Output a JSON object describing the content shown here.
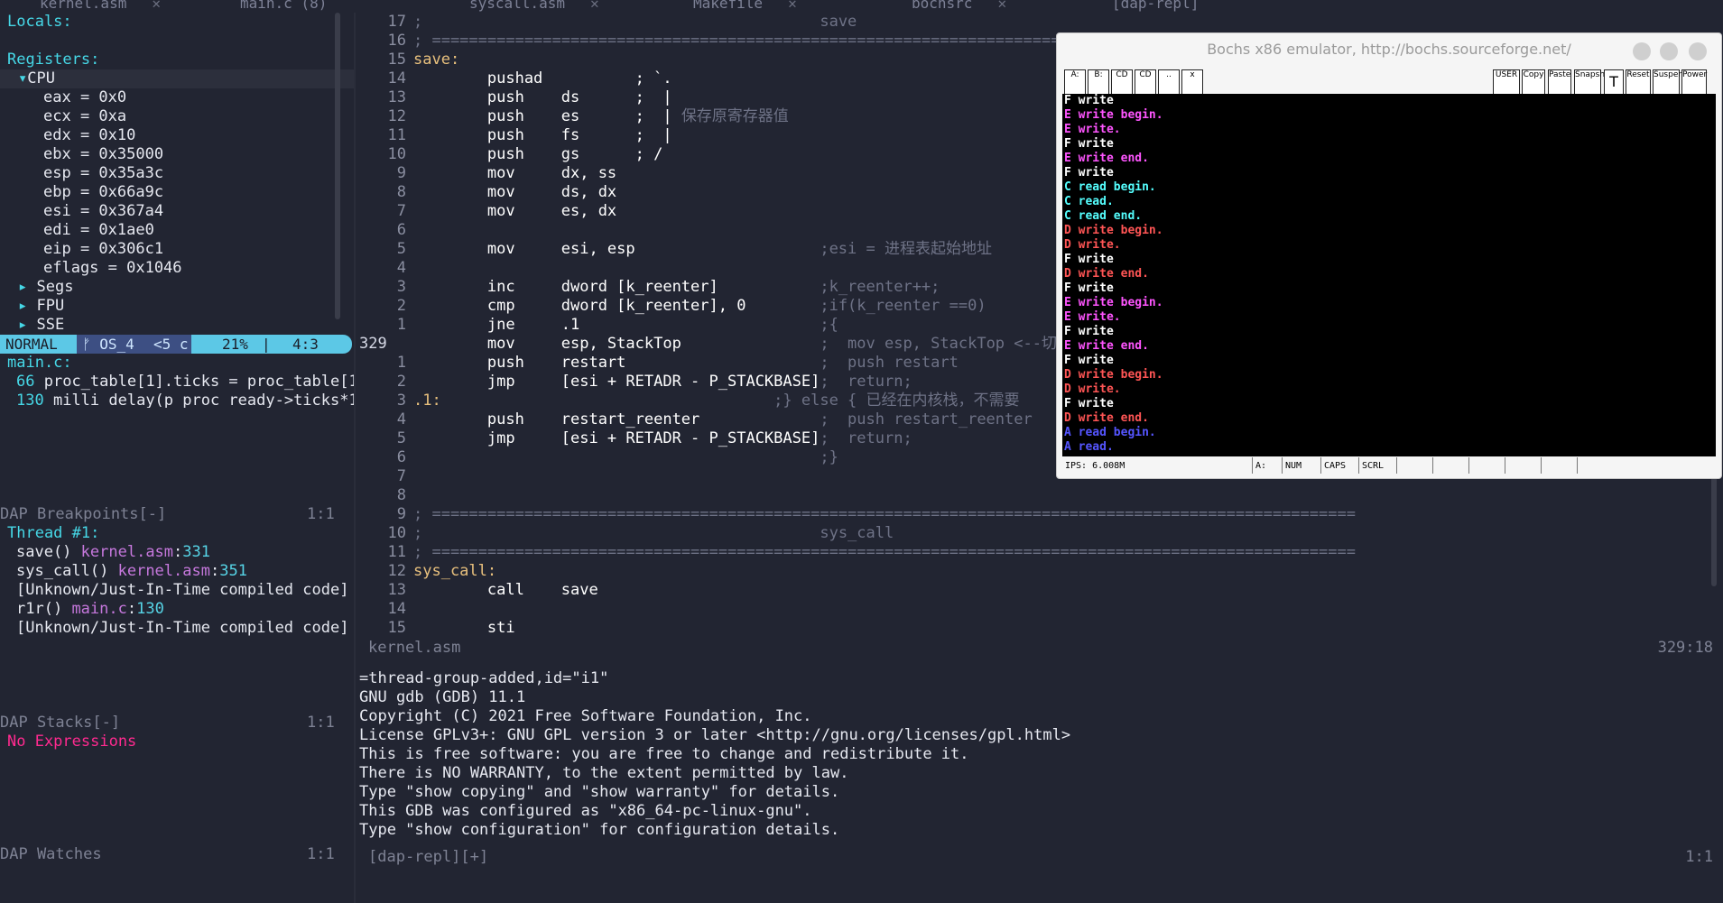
{
  "tabs": [
    {
      "label": "kernel.asm"
    },
    {
      "label": "main.c",
      "extra": "(8)"
    },
    {
      "label": "syscall.asm"
    },
    {
      "label": "Makefile"
    },
    {
      "label": "bochsrc"
    },
    {
      "label": "[dap-repl]"
    }
  ],
  "tab_close": "✕",
  "left": {
    "locals": "Locals:",
    "registers": "Registers:",
    "cpu": "CPU",
    "regs": [
      "eax = 0x0",
      "ecx = 0xa",
      "edx = 0x10",
      "ebx = 0x35000",
      "esp = 0x35a3c",
      "ebp = 0x66a9c",
      "esi = 0x367a4",
      "edi = 0x1ae0",
      "eip = 0x306c1",
      "eflags = 0x1046"
    ],
    "groups": [
      "Segs",
      "FPU",
      "SSE"
    ],
    "status": {
      "mode": "NORMAL",
      "branch": "ᚠ OS_4",
      "info": "<5 c",
      "percent": "21%",
      "pos": "4:3"
    },
    "stack_file": "main.c:",
    "stack_lines": [
      {
        "num": "66",
        "text": "proc_table[1].ticks = proc_table[1"
      },
      {
        "num": "130",
        "text": "milli_delay(p_proc_ready->ticks*1"
      }
    ],
    "breakpoints_title": "DAP Breakpoints[-]",
    "breakpoints_pos": "1:1",
    "thread": "Thread #1:",
    "frames": [
      {
        "func": "save()",
        "file": "kernel.asm",
        "line": "331"
      },
      {
        "func": "sys_call()",
        "file": "kernel.asm",
        "line": "351"
      },
      {
        "func": "[Unknown/Just-In-Time compiled code]",
        "file": "",
        "line": ""
      },
      {
        "func": "r1r()",
        "file": "main.c",
        "line": "130"
      },
      {
        "func": "[Unknown/Just-In-Time compiled code]",
        "file": "",
        "line": ""
      }
    ],
    "stacks_title": "DAP Stacks[-]",
    "stacks_pos": "1:1",
    "no_expressions": "No Expressions",
    "watches_title": "DAP Watches",
    "watches_pos": "1:1"
  },
  "editor": {
    "filename": "kernel.asm",
    "cursor": "329:18",
    "lines": [
      {
        "n": "17",
        "code": "; ",
        "comment": "                                          save"
      },
      {
        "n": "16",
        "code": "; ====================================================================================================",
        "comment": ""
      },
      {
        "n": "15",
        "label": "save:",
        "code": "",
        "comment": ""
      },
      {
        "n": "14",
        "code": "        pushad          ; `.",
        "comment": ""
      },
      {
        "n": "13",
        "code": "        push    ds      ;  |",
        "comment": ""
      },
      {
        "n": "12",
        "code": "        push    es      ;  | ",
        "comment": "保存原寄存器值"
      },
      {
        "n": "11",
        "code": "        push    fs      ;  |",
        "comment": ""
      },
      {
        "n": "10",
        "code": "        push    gs      ; /",
        "comment": ""
      },
      {
        "n": "9",
        "code": "        mov     dx, ss",
        "comment": ""
      },
      {
        "n": "8",
        "code": "        mov     ds, dx",
        "comment": ""
      },
      {
        "n": "7",
        "code": "        mov     es, dx",
        "comment": ""
      },
      {
        "n": "6",
        "code": "",
        "comment": ""
      },
      {
        "n": "5",
        "code": "        mov     esi, esp",
        "comment": "                    ;esi = 进程表起始地址"
      },
      {
        "n": "4",
        "code": "",
        "comment": ""
      },
      {
        "n": "3",
        "code": "        inc     dword [k_reenter]",
        "comment": "           ;k_reenter++;"
      },
      {
        "n": "2",
        "code": "        cmp     dword [k_reenter], 0",
        "comment": "        ;if(k_reenter ==0)"
      },
      {
        "n": "1",
        "code": "        jne     .1",
        "comment": "                          ;{"
      },
      {
        "n": "329",
        "cur": true,
        "code": "        mov     esp, StackTop",
        "comment": "               ;  mov esp, StackTop <--切换"
      },
      {
        "n": "1",
        "code": "        push    restart",
        "comment": "                     ;  push restart"
      },
      {
        "n": "2",
        "code": "        jmp     [esi + RETADR - P_STACKBASE]",
        "comment": ";  return;"
      },
      {
        "n": "3",
        "label": ".1:",
        "code": "",
        "comment": "                                    ;} else { 已经在内核栈，不需要"
      },
      {
        "n": "4",
        "code": "        push    restart_reenter",
        "comment": "             ;  push restart_reenter"
      },
      {
        "n": "5",
        "code": "        jmp     [esi + RETADR - P_STACKBASE]",
        "comment": ";  return;"
      },
      {
        "n": "6",
        "code": "",
        "comment": "                                            ;}"
      },
      {
        "n": "7",
        "code": "",
        "comment": ""
      },
      {
        "n": "8",
        "code": "",
        "comment": ""
      },
      {
        "n": "9",
        "code": "; ====================================================================================================",
        "comment": ""
      },
      {
        "n": "10",
        "code": "; ",
        "comment": "                                          sys_call"
      },
      {
        "n": "11",
        "code": "; ====================================================================================================",
        "comment": ""
      },
      {
        "n": "12",
        "label": "sys_call:",
        "code": "",
        "comment": ""
      },
      {
        "n": "13",
        "code": "        call    save",
        "comment": ""
      },
      {
        "n": "14",
        "code": "",
        "comment": ""
      },
      {
        "n": "15",
        "code": "        sti",
        "comment": ""
      }
    ]
  },
  "repl": {
    "lines": [
      "=thread-group-added,id=\"i1\"",
      "GNU gdb (GDB) 11.1",
      "Copyright (C) 2021 Free Software Foundation, Inc.",
      "License GPLv3+: GNU GPL version 3 or later <http://gnu.org/licenses/gpl.html>",
      "This is free software: you are free to change and redistribute it.",
      "There is NO WARRANTY, to the extent permitted by law.",
      "Type \"show copying\" and \"show warranty\" for details.",
      "This GDB was configured as \"x86_64-pc-linux-gnu\".",
      "Type \"show configuration\" for configuration details."
    ],
    "status_name": "[dap-repl][+]",
    "status_pos": "1:1"
  },
  "bochs": {
    "title": "Bochs x86 emulator, http://bochs.sourceforge.net/",
    "toolbar_left": [
      "A:",
      "B:",
      "CD",
      "CD",
      "..",
      "x"
    ],
    "toolbar_right": [
      "USER",
      "Copy",
      "Paste",
      "Snapshot",
      "T",
      "Reset",
      "Suspend",
      "Power"
    ],
    "screen_lines": [
      {
        "p": "F",
        "t": "write",
        "c": "#ffffff"
      },
      {
        "p": "E",
        "t": "write begin.",
        "c": "#ff55ff"
      },
      {
        "p": "E",
        "t": "write.",
        "c": "#ff55ff"
      },
      {
        "p": "F",
        "t": "write",
        "c": "#ffffff"
      },
      {
        "p": "E",
        "t": "write end.",
        "c": "#ff55ff"
      },
      {
        "p": "F",
        "t": "write",
        "c": "#ffffff"
      },
      {
        "p": "C",
        "t": "read begin.",
        "c": "#55ffff"
      },
      {
        "p": "C",
        "t": "read.",
        "c": "#55ffff"
      },
      {
        "p": "C",
        "t": "read end.",
        "c": "#55ffff"
      },
      {
        "p": "D",
        "t": "write begin.",
        "c": "#ff5555"
      },
      {
        "p": "D",
        "t": "write.",
        "c": "#ff5555"
      },
      {
        "p": "F",
        "t": "write",
        "c": "#ffffff"
      },
      {
        "p": "D",
        "t": "write end.",
        "c": "#ff5555"
      },
      {
        "p": "F",
        "t": "write",
        "c": "#ffffff"
      },
      {
        "p": "E",
        "t": "write begin.",
        "c": "#ff55ff"
      },
      {
        "p": "E",
        "t": "write.",
        "c": "#ff55ff"
      },
      {
        "p": "F",
        "t": "write",
        "c": "#ffffff"
      },
      {
        "p": "E",
        "t": "write end.",
        "c": "#ff55ff"
      },
      {
        "p": "F",
        "t": "write",
        "c": "#ffffff"
      },
      {
        "p": "D",
        "t": "write begin.",
        "c": "#ff5555"
      },
      {
        "p": "D",
        "t": "write.",
        "c": "#ff5555"
      },
      {
        "p": "F",
        "t": "write",
        "c": "#ffffff"
      },
      {
        "p": "D",
        "t": "write end.",
        "c": "#ff5555"
      },
      {
        "p": "A",
        "t": "read begin.",
        "c": "#5555ff"
      },
      {
        "p": "A",
        "t": "read.",
        "c": "#5555ff"
      }
    ],
    "status": {
      "ips": "IPS: 6.008M",
      "drive": "A:",
      "num": "NUM",
      "caps": "CAPS",
      "scrl": "SCRL"
    }
  }
}
